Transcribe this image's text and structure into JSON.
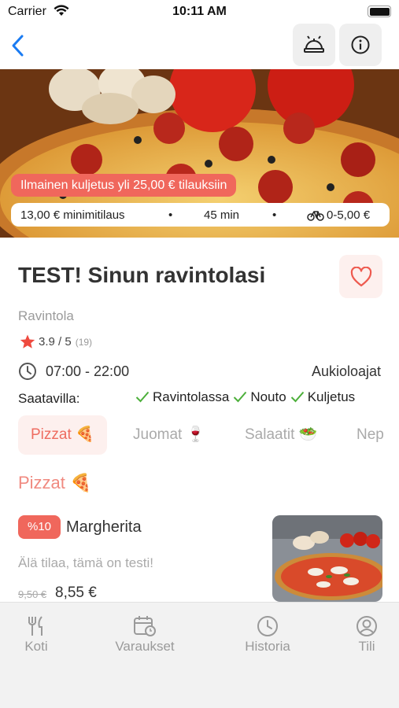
{
  "status": {
    "carrier": "Carrier",
    "time": "10:11 AM"
  },
  "hero": {
    "promo": "Ilmainen kuljetus yli 25,00 € tilauksiin",
    "min_order": "13,00 € minimitilaus",
    "time": "45 min",
    "delivery_fee": "0-5,00 €"
  },
  "restaurant": {
    "name": "TEST! Sinun ravintolasi",
    "category": "Ravintola",
    "rating": "3.9 / 5",
    "rating_count": "(19)",
    "hours": "07:00 - 22:00",
    "hours_label": "Aukioloajat",
    "available_label": "Saatavilla:",
    "available": [
      "Ravintolassa",
      "Nouto",
      "Kuljetus"
    ]
  },
  "tabs": [
    {
      "label": "Pizzat 🍕"
    },
    {
      "label": "Juomat 🍷"
    },
    {
      "label": "Salaatit 🥗"
    },
    {
      "label": "Nep"
    }
  ],
  "section": {
    "title": "Pizzat 🍕"
  },
  "item": {
    "badge": "%10",
    "name": "Margherita",
    "description": "Älä tilaa, tämä on testi!",
    "old_price": "9,50 €",
    "price": "8,55 €"
  },
  "tabbar": {
    "home": "Koti",
    "bookings": "Varaukset",
    "history": "Historia",
    "account": "Tili"
  },
  "colors": {
    "accent": "#f0675c",
    "back": "#1a7bf2",
    "check": "#4caf3a"
  }
}
